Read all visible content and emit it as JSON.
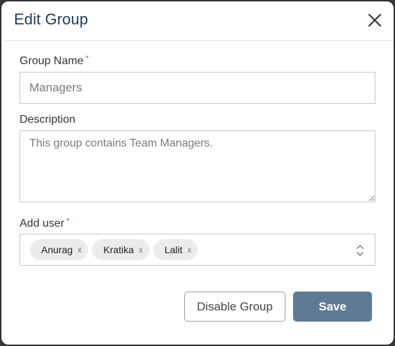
{
  "modal": {
    "title": "Edit Group",
    "close_icon": "close-icon"
  },
  "group_name": {
    "label": "Group Name",
    "required_mark": "*",
    "value": "Managers"
  },
  "description": {
    "label": "Description",
    "value": "This group contains Team Managers."
  },
  "add_user": {
    "label": "Add user",
    "required_mark": "*",
    "chips": [
      {
        "name": "Anurag",
        "remove": "x"
      },
      {
        "name": "Kratika",
        "remove": "x"
      },
      {
        "name": "Lalit",
        "remove": "x"
      }
    ],
    "toggle_icon": "chevron-up-down-icon"
  },
  "actions": {
    "disable_label": "Disable Group",
    "save_label": "Save"
  },
  "colors": {
    "title": "#1f3b5c",
    "required": "#d23b3b",
    "primary_button": "#5f7a94"
  }
}
